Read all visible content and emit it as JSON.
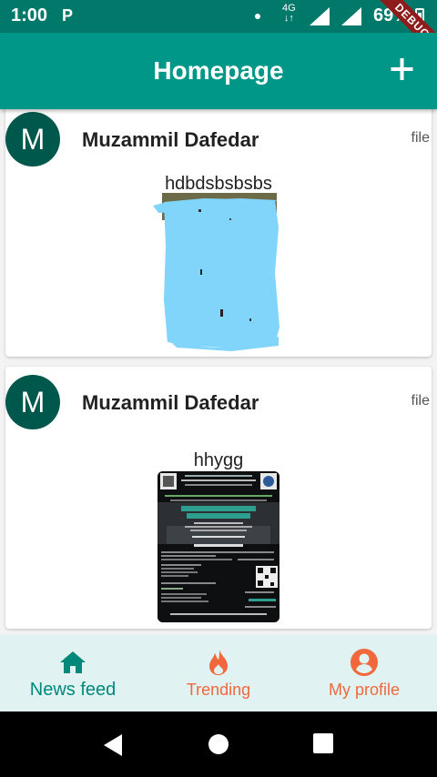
{
  "status_bar": {
    "time": "1:00",
    "notification_letter": "P",
    "network": "4G",
    "battery": "69%"
  },
  "debug_banner": "DEBUG",
  "app_bar": {
    "title": "Homepage",
    "add_icon": "plus-icon"
  },
  "feed": {
    "posts": [
      {
        "avatar_letter": "M",
        "author": "Muzammil Dafedar",
        "type": "file",
        "caption": "hdbdsbsbsbs",
        "image": "light-blue-scribble"
      },
      {
        "avatar_letter": "M",
        "author": "Muzammil Dafedar",
        "type": "file",
        "caption": "hhygg",
        "image": "event-poster"
      }
    ]
  },
  "poster": {
    "heading": "ADVANCED C & KERNEL PROGRAMMING"
  },
  "bottom_nav": {
    "items": [
      {
        "label": "News feed",
        "icon": "home-icon",
        "color": "#00897b",
        "active": true
      },
      {
        "label": "Trending",
        "icon": "fire-icon",
        "color": "#f0683c",
        "active": false
      },
      {
        "label": "My profile",
        "icon": "account-circle-icon",
        "color": "#f0683c",
        "active": false
      }
    ]
  },
  "colors": {
    "status_bar": "#00796b",
    "app_bar": "#009688",
    "avatar": "#00574b",
    "bottom_nav_bg": "#e0f2f1",
    "scribble": "#81d4fa"
  }
}
